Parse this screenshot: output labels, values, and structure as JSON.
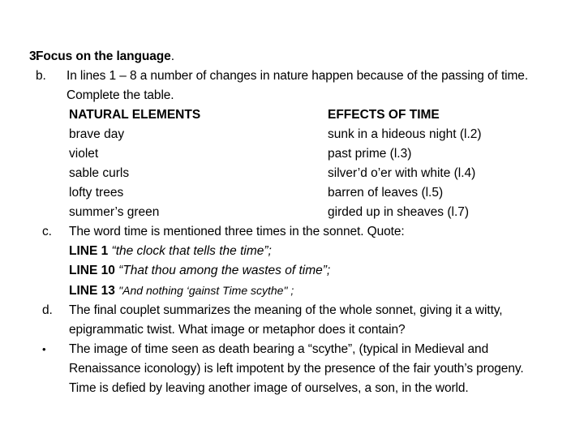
{
  "slide": {
    "heading": {
      "marker": "3.",
      "text": "Focus on the language",
      "trailing": "."
    },
    "item_b": {
      "marker": "b.",
      "text": "In lines 1 – 8 a number of changes in nature happen because of the passing of time. Complete the table."
    },
    "table": {
      "headers": {
        "natural_elements": "NATURAL ELEMENTS",
        "effects_of_time": "EFFECTS OF TIME"
      },
      "rows": [
        {
          "element": "brave day",
          "effect": "sunk in a hideous night (l.2)"
        },
        {
          "element": "violet",
          "effect": "past prime (l.3)"
        },
        {
          "element": "sable curls",
          "effect": "silver’d  o’er with white (l.4)"
        },
        {
          "element": "lofty trees",
          "effect": "barren of leaves (l.5)"
        },
        {
          "element": "summer’s green",
          "effect": "girded up in sheaves (l.7)"
        }
      ]
    },
    "item_c": {
      "marker": "c.",
      "text": "The word time is mentioned three times in the sonnet. Quote:",
      "quotes": [
        {
          "line_label": "LINE 1",
          "quote": "“the clock that tells the time”;"
        },
        {
          "line_label": "LINE 10",
          "quote": "“That thou among the wastes of time”;"
        },
        {
          "line_label": "LINE 13",
          "quote": "\"And nothing ‘gainst Time scythe\" ;"
        }
      ]
    },
    "item_d": {
      "marker": "d.",
      "text": "The final couplet summarizes the meaning of the whole sonnet, giving it a witty, epigrammatic twist. What image or metaphor does it contain?"
    },
    "item_bullet": {
      "marker": "•",
      "text": "The image of time seen as death bearing a “scythe”, (typical in Medieval and Renaissance iconology) is left impotent by the presence of the fair youth’s progeny. Time is defied by leaving another image of ourselves, a son, in the world."
    }
  }
}
